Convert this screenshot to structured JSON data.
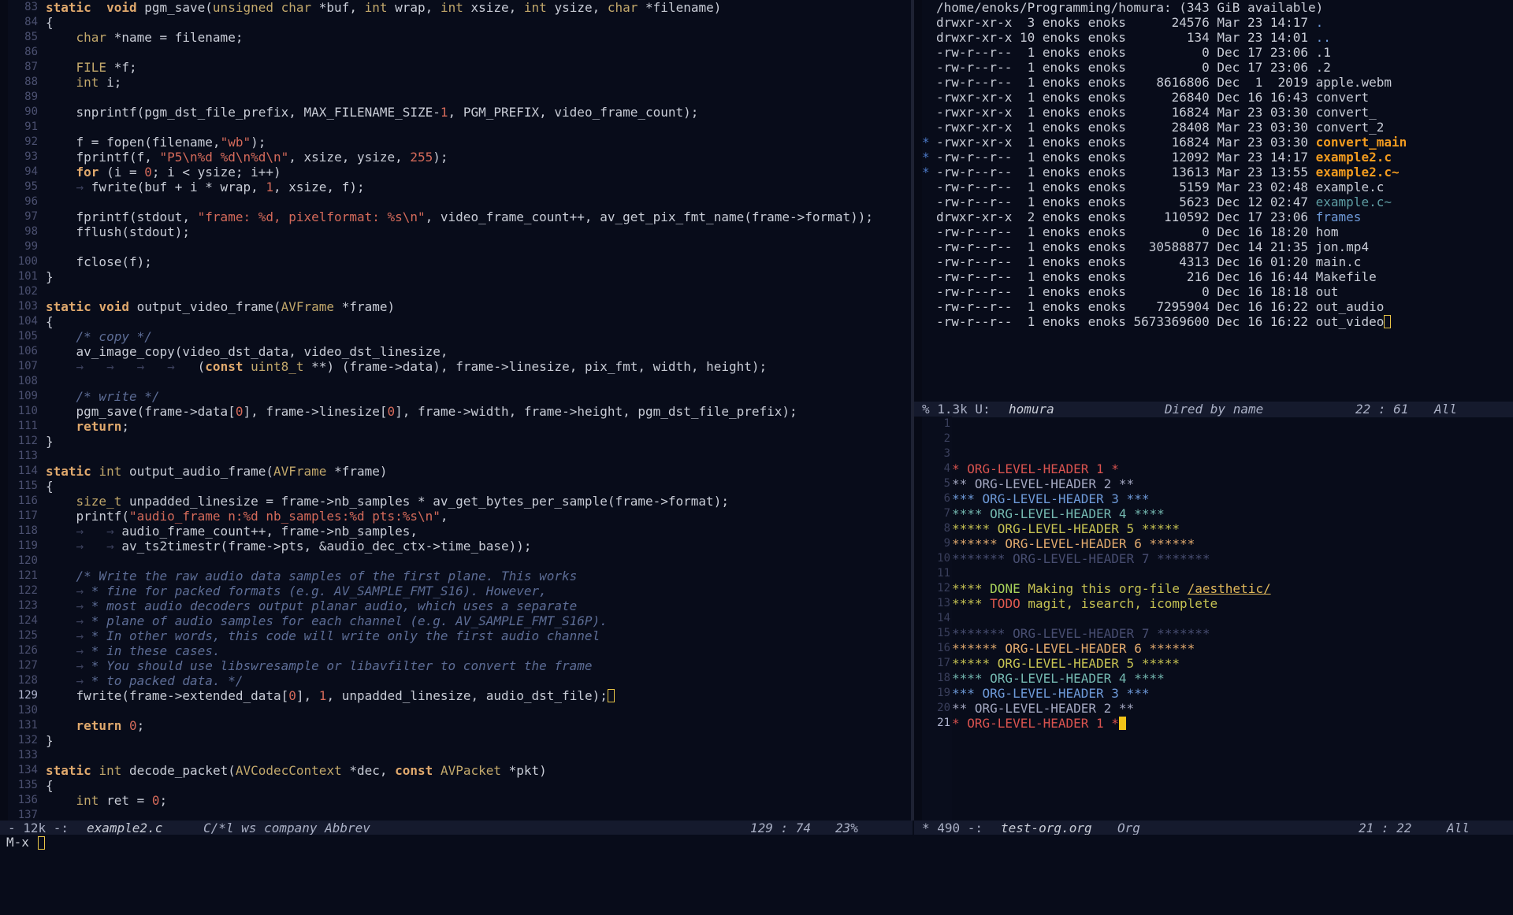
{
  "left_window": {
    "first_line": 83,
    "current_line": 129,
    "code_lines": [
      [
        [
          "kw",
          "static"
        ],
        [
          "",
          "  "
        ],
        [
          "kw",
          "void"
        ],
        [
          "",
          " pgm_save("
        ],
        [
          "ty",
          "unsigned"
        ],
        [
          "",
          " "
        ],
        [
          "ty",
          "char"
        ],
        [
          "",
          " *buf, "
        ],
        [
          "ty",
          "int"
        ],
        [
          "",
          " wrap, "
        ],
        [
          "ty",
          "int"
        ],
        [
          "",
          " xsize, "
        ],
        [
          "ty",
          "int"
        ],
        [
          "",
          " ysize, "
        ],
        [
          "ty",
          "char"
        ],
        [
          "",
          " *filename)"
        ]
      ],
      [
        [
          "",
          "{"
        ]
      ],
      [
        [
          "ws",
          "    "
        ],
        [
          "ty",
          "char"
        ],
        [
          "",
          " *name = filename;"
        ]
      ],
      [],
      [
        [
          "ws",
          "    "
        ],
        [
          "ty",
          "FILE"
        ],
        [
          "",
          " *f;"
        ]
      ],
      [
        [
          "ws",
          "    "
        ],
        [
          "ty",
          "int"
        ],
        [
          "",
          " i;"
        ]
      ],
      [],
      [
        [
          "ws",
          "    "
        ],
        [
          "",
          "snprintf(pgm_dst_file_prefix, MAX_FILENAME_SIZE-"
        ],
        [
          "nu",
          "1"
        ],
        [
          "",
          ", PGM_PREFIX, video_frame_count);"
        ]
      ],
      [],
      [
        [
          "ws",
          "    "
        ],
        [
          "",
          "f = fopen(filename,"
        ],
        [
          "st",
          "\"wb\""
        ],
        [
          "",
          ");"
        ]
      ],
      [
        [
          "ws",
          "    "
        ],
        [
          "",
          "fprintf(f, "
        ],
        [
          "st",
          "\"P5\\n%d %d\\n%d\\n\""
        ],
        [
          "",
          ", xsize, ysize, "
        ],
        [
          "nu",
          "255"
        ],
        [
          "",
          ");"
        ]
      ],
      [
        [
          "ws",
          "    "
        ],
        [
          "kw",
          "for"
        ],
        [
          "",
          " (i = "
        ],
        [
          "nu",
          "0"
        ],
        [
          "",
          "; i < ysize; i++)"
        ]
      ],
      [
        [
          "ws",
          "    → "
        ],
        [
          "",
          "fwrite(buf + i * wrap, "
        ],
        [
          "nu",
          "1"
        ],
        [
          "",
          ", xsize, f);"
        ]
      ],
      [],
      [
        [
          "ws",
          "    "
        ],
        [
          "",
          "fprintf(stdout, "
        ],
        [
          "st",
          "\"frame: %d, pixelformat: %s\\n\""
        ],
        [
          "",
          ", video_frame_count++, av_get_pix_fmt_name(frame->format));"
        ]
      ],
      [
        [
          "ws",
          "    "
        ],
        [
          "",
          "fflush(stdout);"
        ]
      ],
      [],
      [
        [
          "ws",
          "    "
        ],
        [
          "",
          "fclose(f);"
        ]
      ],
      [
        [
          "",
          "}"
        ]
      ],
      [],
      [
        [
          "kw",
          "static"
        ],
        [
          "",
          " "
        ],
        [
          "kw",
          "void"
        ],
        [
          "",
          " output_video_frame("
        ],
        [
          "ty",
          "AVFrame"
        ],
        [
          "",
          " *frame)"
        ]
      ],
      [
        [
          "",
          "{"
        ]
      ],
      [
        [
          "ws",
          "    "
        ],
        [
          "cm",
          "/* copy */"
        ]
      ],
      [
        [
          "ws",
          "    "
        ],
        [
          "",
          "av_image_copy(video_dst_data, video_dst_linesize,"
        ]
      ],
      [
        [
          "ws",
          "    →   →   →   →   "
        ],
        [
          "",
          "("
        ],
        [
          "kw",
          "const"
        ],
        [
          "",
          " "
        ],
        [
          "ty",
          "uint8_t"
        ],
        [
          "",
          " **) (frame->data), frame->linesize, pix_fmt, width, height);"
        ]
      ],
      [],
      [
        [
          "ws",
          "    "
        ],
        [
          "cm",
          "/* write */"
        ]
      ],
      [
        [
          "ws",
          "    "
        ],
        [
          "",
          "pgm_save(frame->data["
        ],
        [
          "nu",
          "0"
        ],
        [
          "",
          "], frame->linesize["
        ],
        [
          "nu",
          "0"
        ],
        [
          "",
          "], frame->width, frame->height, pgm_dst_file_prefix);"
        ]
      ],
      [
        [
          "ws",
          "    "
        ],
        [
          "kw",
          "return"
        ],
        [
          "",
          ";"
        ]
      ],
      [
        [
          "",
          "}"
        ]
      ],
      [],
      [
        [
          "kw",
          "static"
        ],
        [
          "",
          " "
        ],
        [
          "ty",
          "int"
        ],
        [
          "",
          " output_audio_frame("
        ],
        [
          "ty",
          "AVFrame"
        ],
        [
          "",
          " *frame)"
        ]
      ],
      [
        [
          "",
          "{"
        ]
      ],
      [
        [
          "ws",
          "    "
        ],
        [
          "ty",
          "size_t"
        ],
        [
          "",
          " unpadded_linesize = frame->nb_samples * av_get_bytes_per_sample(frame->format);"
        ]
      ],
      [
        [
          "ws",
          "    "
        ],
        [
          "",
          "printf("
        ],
        [
          "st",
          "\"audio_frame n:%d nb_samples:%d pts:%s\\n\""
        ],
        [
          "",
          ","
        ]
      ],
      [
        [
          "ws",
          "    →   → "
        ],
        [
          "",
          "audio_frame_count++, frame->nb_samples,"
        ]
      ],
      [
        [
          "ws",
          "    →   → "
        ],
        [
          "",
          "av_ts2timestr(frame->pts, &audio_dec_ctx->time_base));"
        ]
      ],
      [],
      [
        [
          "ws",
          "    "
        ],
        [
          "cm",
          "/* Write the raw audio data samples of the first plane. This works"
        ]
      ],
      [
        [
          "ws",
          "    → "
        ],
        [
          "cm",
          "* fine for packed formats (e.g. AV_SAMPLE_FMT_S16). However,"
        ]
      ],
      [
        [
          "ws",
          "    → "
        ],
        [
          "cm",
          "* most audio decoders output planar audio, which uses a separate"
        ]
      ],
      [
        [
          "ws",
          "    → "
        ],
        [
          "cm",
          "* plane of audio samples for each channel (e.g. AV_SAMPLE_FMT_S16P)."
        ]
      ],
      [
        [
          "ws",
          "    → "
        ],
        [
          "cm",
          "* In other words, this code will write only the first audio channel"
        ]
      ],
      [
        [
          "ws",
          "    → "
        ],
        [
          "cm",
          "* in these cases."
        ]
      ],
      [
        [
          "ws",
          "    → "
        ],
        [
          "cm",
          "* You should use libswresample or libavfilter to convert the frame"
        ]
      ],
      [
        [
          "ws",
          "    → "
        ],
        [
          "cm",
          "* to packed data. */"
        ]
      ],
      [
        [
          "ws",
          "    "
        ],
        [
          "",
          "fwrite(frame->extended_data["
        ],
        [
          "nu",
          "0"
        ],
        [
          "",
          "], "
        ],
        [
          "nu",
          "1"
        ],
        [
          "",
          ", unpadded_linesize, audio_dst_file);"
        ],
        [
          "cursor",
          ""
        ]
      ],
      [],
      [
        [
          "ws",
          "    "
        ],
        [
          "kw",
          "return"
        ],
        [
          "",
          " "
        ],
        [
          "nu",
          "0"
        ],
        [
          "",
          ";"
        ]
      ],
      [
        [
          "",
          "}"
        ]
      ],
      [],
      [
        [
          "kw",
          "static"
        ],
        [
          "",
          " "
        ],
        [
          "ty",
          "int"
        ],
        [
          "",
          " decode_packet("
        ],
        [
          "ty",
          "AVCodecContext"
        ],
        [
          "",
          " *dec, "
        ],
        [
          "kw",
          "const"
        ],
        [
          "",
          " "
        ],
        [
          "ty",
          "AVPacket"
        ],
        [
          "",
          " *pkt)"
        ]
      ],
      [
        [
          "",
          "{"
        ]
      ],
      [
        [
          "ws",
          "    "
        ],
        [
          "ty",
          "int"
        ],
        [
          "",
          " ret = "
        ],
        [
          "nu",
          "0"
        ],
        [
          "",
          ";"
        ]
      ],
      []
    ],
    "modeline": {
      "status": "- 12k -:",
      "buffer": "example2.c",
      "modes": "C/*l ws company Abbrev",
      "position": "129 : 74",
      "percent": "23%"
    }
  },
  "dired_window": {
    "header_path": "/home/enoks/Programming/homura:",
    "header_avail": " (343 GiB available)",
    "entries": [
      {
        "mark": "",
        "perms": "drwxr-xr-x",
        "links": "3",
        "owner": "enoks",
        "group": "enoks",
        "size": "24576",
        "date": "Mar 23 14:17",
        "name": ".",
        "kind": "dir"
      },
      {
        "mark": "",
        "perms": "drwxr-xr-x",
        "links": "10",
        "owner": "enoks",
        "group": "enoks",
        "size": "134",
        "date": "Mar 23 14:01",
        "name": "..",
        "kind": "dir"
      },
      {
        "mark": "",
        "perms": "-rw-r--r--",
        "links": "1",
        "owner": "enoks",
        "group": "enoks",
        "size": "0",
        "date": "Dec 17 23:06",
        "name": ".1",
        "kind": "file"
      },
      {
        "mark": "",
        "perms": "-rw-r--r--",
        "links": "1",
        "owner": "enoks",
        "group": "enoks",
        "size": "0",
        "date": "Dec 17 23:06",
        "name": ".2",
        "kind": "file"
      },
      {
        "mark": "",
        "perms": "-rw-r--r--",
        "links": "1",
        "owner": "enoks",
        "group": "enoks",
        "size": "8616806",
        "date": "Dec  1  2019",
        "name": "apple.webm",
        "kind": "file"
      },
      {
        "mark": "",
        "perms": "-rwxr-xr-x",
        "links": "1",
        "owner": "enoks",
        "group": "enoks",
        "size": "26840",
        "date": "Dec 16 16:43",
        "name": "convert",
        "kind": "file"
      },
      {
        "mark": "",
        "perms": "-rwxr-xr-x",
        "links": "1",
        "owner": "enoks",
        "group": "enoks",
        "size": "16824",
        "date": "Mar 23 03:30",
        "name": "convert_",
        "kind": "file"
      },
      {
        "mark": "",
        "perms": "-rwxr-xr-x",
        "links": "1",
        "owner": "enoks",
        "group": "enoks",
        "size": "28408",
        "date": "Mar 23 03:30",
        "name": "convert_2",
        "kind": "file"
      },
      {
        "mark": "*",
        "perms": "-rwxr-xr-x",
        "links": "1",
        "owner": "enoks",
        "group": "enoks",
        "size": "16824",
        "date": "Mar 23 03:30",
        "name": "convert_main",
        "kind": "marked"
      },
      {
        "mark": "*",
        "perms": "-rw-r--r--",
        "links": "1",
        "owner": "enoks",
        "group": "enoks",
        "size": "12092",
        "date": "Mar 23 14:17",
        "name": "example2.c",
        "kind": "marked"
      },
      {
        "mark": "*",
        "perms": "-rw-r--r--",
        "links": "1",
        "owner": "enoks",
        "group": "enoks",
        "size": "13613",
        "date": "Mar 23 13:55",
        "name": "example2.c~",
        "kind": "marked"
      },
      {
        "mark": "",
        "perms": "-rw-r--r--",
        "links": "1",
        "owner": "enoks",
        "group": "enoks",
        "size": "5159",
        "date": "Mar 23 02:48",
        "name": "example.c",
        "kind": "file"
      },
      {
        "mark": "",
        "perms": "-rw-r--r--",
        "links": "1",
        "owner": "enoks",
        "group": "enoks",
        "size": "5623",
        "date": "Dec 12 02:47",
        "name": "example.c~",
        "kind": "backup"
      },
      {
        "mark": "",
        "perms": "drwxr-xr-x",
        "links": "2",
        "owner": "enoks",
        "group": "enoks",
        "size": "110592",
        "date": "Dec 17 23:06",
        "name": "frames",
        "kind": "dir"
      },
      {
        "mark": "",
        "perms": "-rw-r--r--",
        "links": "1",
        "owner": "enoks",
        "group": "enoks",
        "size": "0",
        "date": "Dec 16 18:20",
        "name": "hom",
        "kind": "file"
      },
      {
        "mark": "",
        "perms": "-rw-r--r--",
        "links": "1",
        "owner": "enoks",
        "group": "enoks",
        "size": "30588877",
        "date": "Dec 14 21:35",
        "name": "jon.mp4",
        "kind": "file"
      },
      {
        "mark": "",
        "perms": "-rw-r--r--",
        "links": "1",
        "owner": "enoks",
        "group": "enoks",
        "size": "4313",
        "date": "Dec 16 01:20",
        "name": "main.c",
        "kind": "file"
      },
      {
        "mark": "",
        "perms": "-rw-r--r--",
        "links": "1",
        "owner": "enoks",
        "group": "enoks",
        "size": "216",
        "date": "Dec 16 16:44",
        "name": "Makefile",
        "kind": "file"
      },
      {
        "mark": "",
        "perms": "-rw-r--r--",
        "links": "1",
        "owner": "enoks",
        "group": "enoks",
        "size": "0",
        "date": "Dec 16 18:18",
        "name": "out",
        "kind": "file"
      },
      {
        "mark": "",
        "perms": "-rw-r--r--",
        "links": "1",
        "owner": "enoks",
        "group": "enoks",
        "size": "7295904",
        "date": "Dec 16 16:22",
        "name": "out_audio",
        "kind": "file"
      },
      {
        "mark": "",
        "perms": "-rw-r--r--",
        "links": "1",
        "owner": "enoks",
        "group": "enoks",
        "size": "5673369600",
        "date": "Dec 16 16:22",
        "name": "out_video",
        "kind": "file",
        "cursor": true
      }
    ],
    "modeline": {
      "status": "% 1.3k U:",
      "buffer": "homura",
      "modes": "Dired by name",
      "position": "22 : 61",
      "percent": "All"
    }
  },
  "org_window": {
    "current_line": 21,
    "lines": [
      [],
      [],
      [],
      [
        [
          "h1",
          "* ORG-LEVEL-HEADER 1 *"
        ]
      ],
      [
        [
          "h2",
          "** ORG-LEVEL-HEADER 2 **"
        ]
      ],
      [
        [
          "h3",
          "*** ORG-LEVEL-HEADER 3 ***"
        ]
      ],
      [
        [
          "h4",
          "**** ORG-LEVEL-HEADER 4 ****"
        ]
      ],
      [
        [
          "h5",
          "***** ORG-LEVEL-HEADER 5 *****"
        ]
      ],
      [
        [
          "h6",
          "****** ORG-LEVEL-HEADER 6 ******"
        ]
      ],
      [
        [
          "h7",
          "******* ORG-LEVEL-HEADER 7 *******"
        ]
      ],
      [],
      [
        [
          "h5",
          "**** "
        ],
        [
          "done",
          "DONE"
        ],
        [
          "h5",
          " Making this org-file "
        ],
        [
          "link",
          "/aesthetic/"
        ]
      ],
      [
        [
          "h5",
          "**** "
        ],
        [
          "todo",
          "TODO"
        ],
        [
          "h5",
          " magit, isearch, icomplete"
        ]
      ],
      [],
      [
        [
          "h7",
          "******* ORG-LEVEL-HEADER 7 *******"
        ]
      ],
      [
        [
          "h6",
          "****** ORG-LEVEL-HEADER 6 ******"
        ]
      ],
      [
        [
          "h5",
          "***** ORG-LEVEL-HEADER 5 *****"
        ]
      ],
      [
        [
          "h4",
          "**** ORG-LEVEL-HEADER 4 ****"
        ]
      ],
      [
        [
          "h3",
          "*** ORG-LEVEL-HEADER 3 ***"
        ]
      ],
      [
        [
          "h2",
          "** ORG-LEVEL-HEADER 2 **"
        ]
      ],
      [
        [
          "h1",
          "* ORG-LEVEL-HEADER 1 *"
        ],
        [
          "cursorfill",
          ""
        ]
      ]
    ],
    "modeline": {
      "status": "* 490 -:",
      "buffer": "test-org.org",
      "modes": "Org",
      "position": "21 : 22",
      "percent": "All"
    }
  },
  "minibuffer": {
    "prompt": "M-x "
  }
}
